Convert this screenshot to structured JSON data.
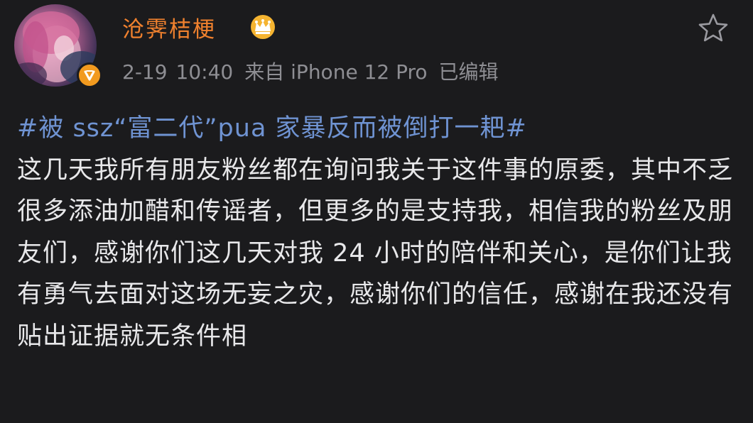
{
  "post": {
    "author": {
      "name": "沧霁桔梗"
    },
    "meta": {
      "date": "2-19",
      "time": "10:40",
      "source": "来自 iPhone 12 Pro",
      "edited": "已编辑"
    },
    "hashtag": "#被 ssz“富二代”pua 家暴反而被倒打一耙#",
    "content": "这几天我所有朋友粉丝都在询问我关于这件事的原委，其中不乏很多添油加醋和传谣者，但更多的是支持我，相信我的粉丝及朋友们，感谢你们这几天对我 24 小时的陪伴和关心，是你们让我有勇气去面对这场无妄之灾，感谢你们的信任，感谢在我还没有贴出证据就无条件相"
  },
  "icons": {
    "crown": "crown-icon",
    "star": "star-icon",
    "verified": "verified-icon"
  },
  "colors": {
    "background": "#1b1b1d",
    "username": "#f0812e",
    "hashtag": "#6f93d2",
    "meta": "#8e8e93",
    "text": "#e8e8ea",
    "verified": "#f29a1f"
  }
}
